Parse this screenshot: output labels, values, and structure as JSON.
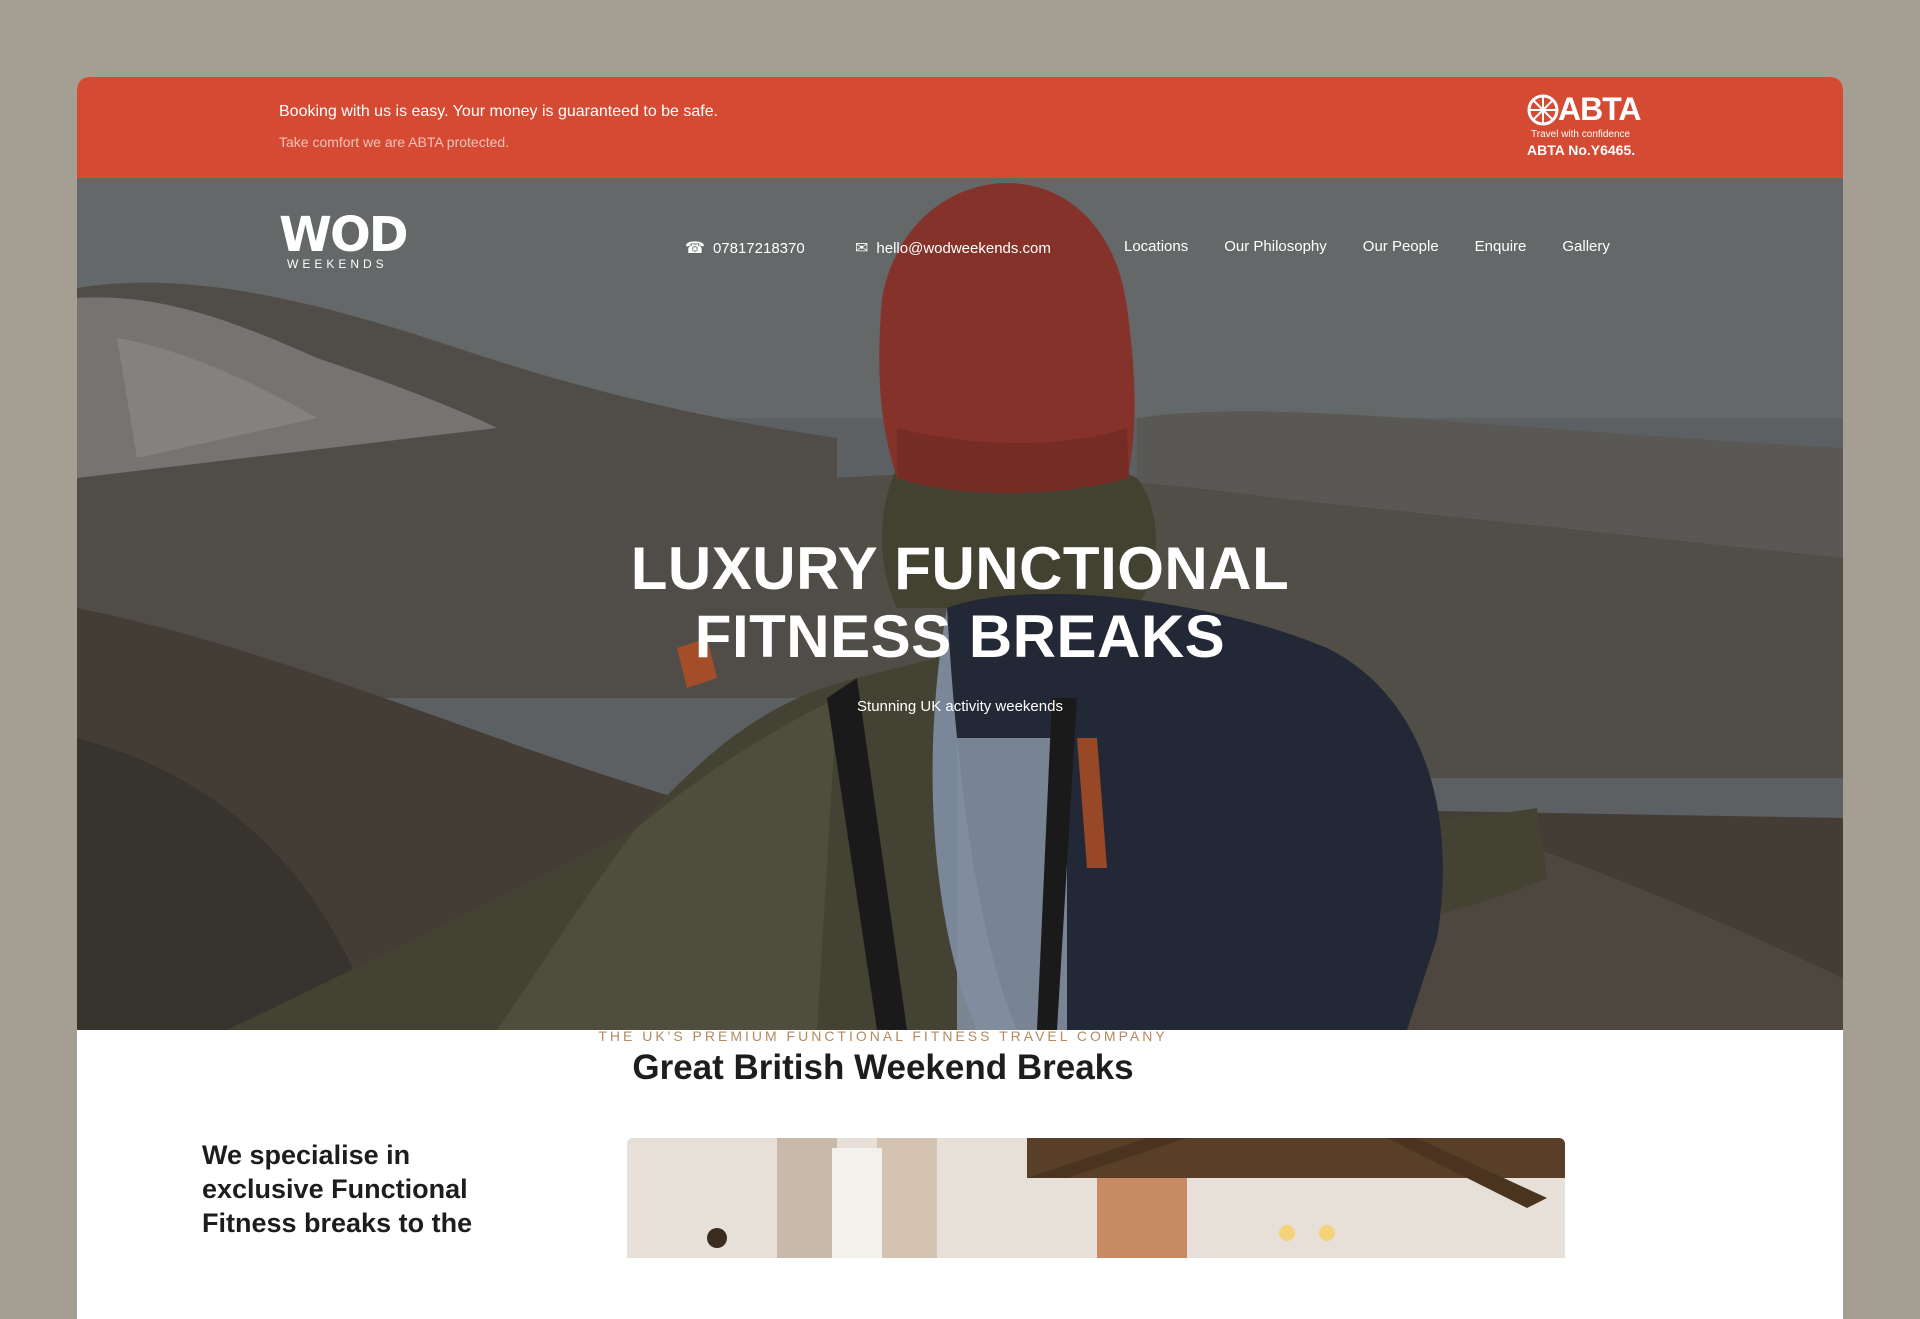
{
  "topbar": {
    "message": "Booking with us is easy. Your money is guaranteed to be safe.",
    "submessage": "Take comfort we are ABTA protected.",
    "badge": {
      "word": "ABTA",
      "tagline": "Travel with confidence",
      "number": "ABTA No.Y6465."
    }
  },
  "header": {
    "logo_main": "WOD",
    "logo_sub": "WEEKENDS",
    "phone": "07817218370",
    "email": "hello@wodweekends.com",
    "nav": [
      "Locations",
      "Our Philosophy",
      "Our People",
      "Enquire",
      "Gallery"
    ]
  },
  "hero": {
    "title_line1": "LUXURY FUNCTIONAL",
    "title_line2": "FITNESS BREAKS",
    "subtitle": "Stunning UK activity weekends"
  },
  "section": {
    "eyebrow": "THE UK'S PREMIUM FUNCTIONAL FITNESS TRAVEL COMPANY",
    "heading": "Great British Weekend Breaks",
    "intro": "We specialise in exclusive Functional Fitness breaks to the"
  },
  "colors": {
    "brand_red": "#d44a33",
    "backdrop": "#a59e92",
    "eyebrow_gold": "#b38a62",
    "heading_dark": "#1d1d1d"
  },
  "icons": {
    "phone": "phone-icon",
    "email": "envelope-icon"
  }
}
